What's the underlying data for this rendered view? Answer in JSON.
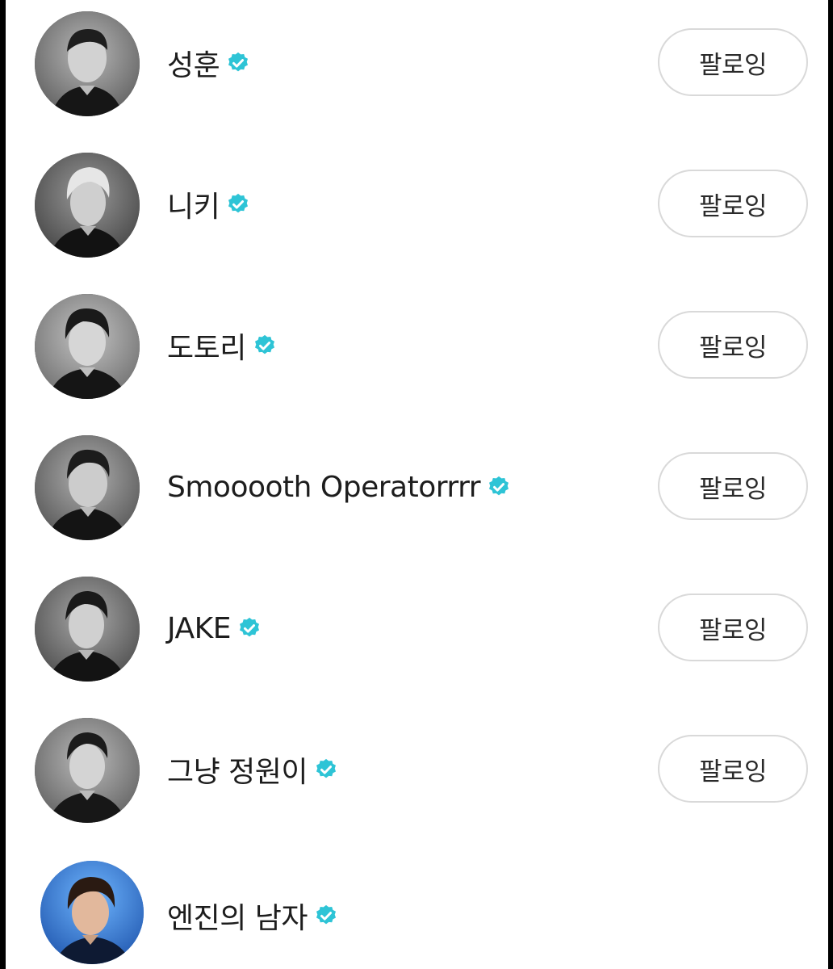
{
  "following_list": {
    "accent_color": "#2ec4d6",
    "items": [
      {
        "name": "성훈",
        "verified": true,
        "button_label": "팔로잉",
        "avatar_icon": "profile-photo-bw"
      },
      {
        "name": "니키",
        "verified": true,
        "button_label": "팔로잉",
        "avatar_icon": "profile-photo-bw"
      },
      {
        "name": "도토리",
        "verified": true,
        "button_label": "팔로잉",
        "avatar_icon": "profile-photo-bw"
      },
      {
        "name": "Smooooth Operatorrrr",
        "verified": true,
        "button_label": "팔로잉",
        "avatar_icon": "profile-photo-bw"
      },
      {
        "name": "JAKE",
        "verified": true,
        "button_label": "팔로잉",
        "avatar_icon": "profile-photo-bw"
      },
      {
        "name": "그냥 정원이",
        "verified": true,
        "button_label": "팔로잉",
        "avatar_icon": "profile-photo-bw"
      },
      {
        "name": "엔진의 남자",
        "verified": true,
        "avatar_icon": "profile-photo-blue"
      }
    ]
  }
}
